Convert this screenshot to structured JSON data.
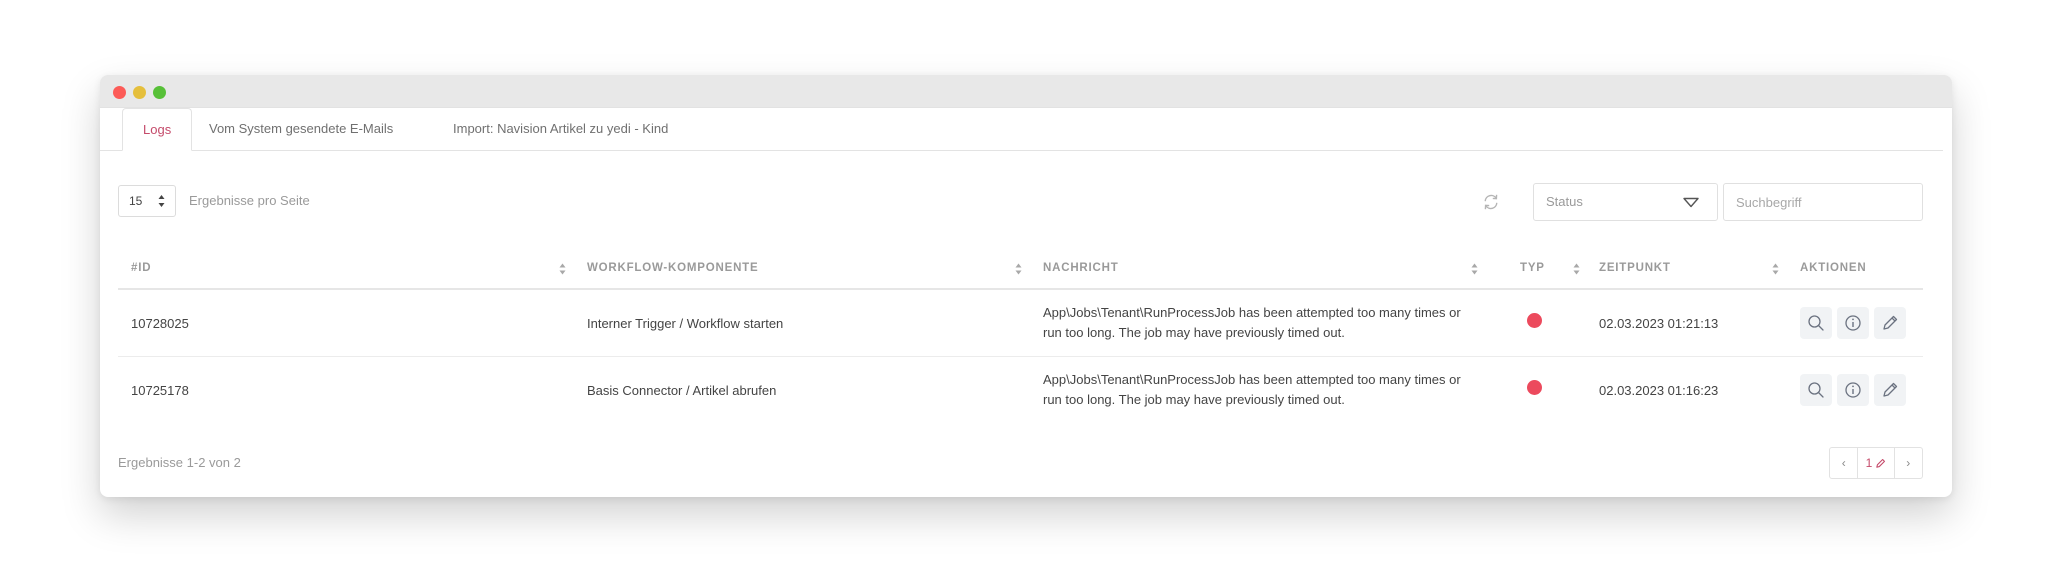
{
  "window": {
    "controls": [
      "close",
      "minimize",
      "maximize"
    ]
  },
  "tabs": [
    {
      "label": "Logs",
      "active": true
    },
    {
      "label": "Vom System gesendete E-Mails",
      "active": false
    },
    {
      "label": "Import: Navision Artikel zu yedi - Kind",
      "active": false
    }
  ],
  "toolbar": {
    "per_page_value": "15",
    "per_page_label": "Ergebnisse pro Seite",
    "refresh_icon": "refresh-icon",
    "status_placeholder": "Status",
    "search_placeholder": "Suchbegriff"
  },
  "table": {
    "columns": [
      "#ID",
      "WORKFLOW-KOMPONENTE",
      "NACHRICHT",
      "TYP",
      "ZEITPUNKT",
      "AKTIONEN"
    ],
    "rows": [
      {
        "id": "10728025",
        "component": "Interner Trigger / Workflow starten",
        "message_line1": "App\\Jobs\\Tenant\\RunProcessJob has been attempted too many times or",
        "message_line2": "run too long. The job may have previously timed out.",
        "type": "error",
        "timestamp": "02.03.2023 01:21:13"
      },
      {
        "id": "10725178",
        "component": "Basis Connector / Artikel abrufen",
        "message_line1": "App\\Jobs\\Tenant\\RunProcessJob has been attempted too many times or",
        "message_line2": "run too long. The job may have previously timed out.",
        "type": "error",
        "timestamp": "02.03.2023 01:16:23"
      }
    ],
    "actions": [
      "search-icon",
      "info-icon",
      "edit-icon"
    ]
  },
  "footer": {
    "results_text": "Ergebnisse 1-2 von 2",
    "prev": "‹",
    "current_page": "1",
    "next": "›"
  },
  "colors": {
    "accent": "#c54b6b",
    "error": "#ec4a5d",
    "muted_text": "#9a9a9a"
  }
}
